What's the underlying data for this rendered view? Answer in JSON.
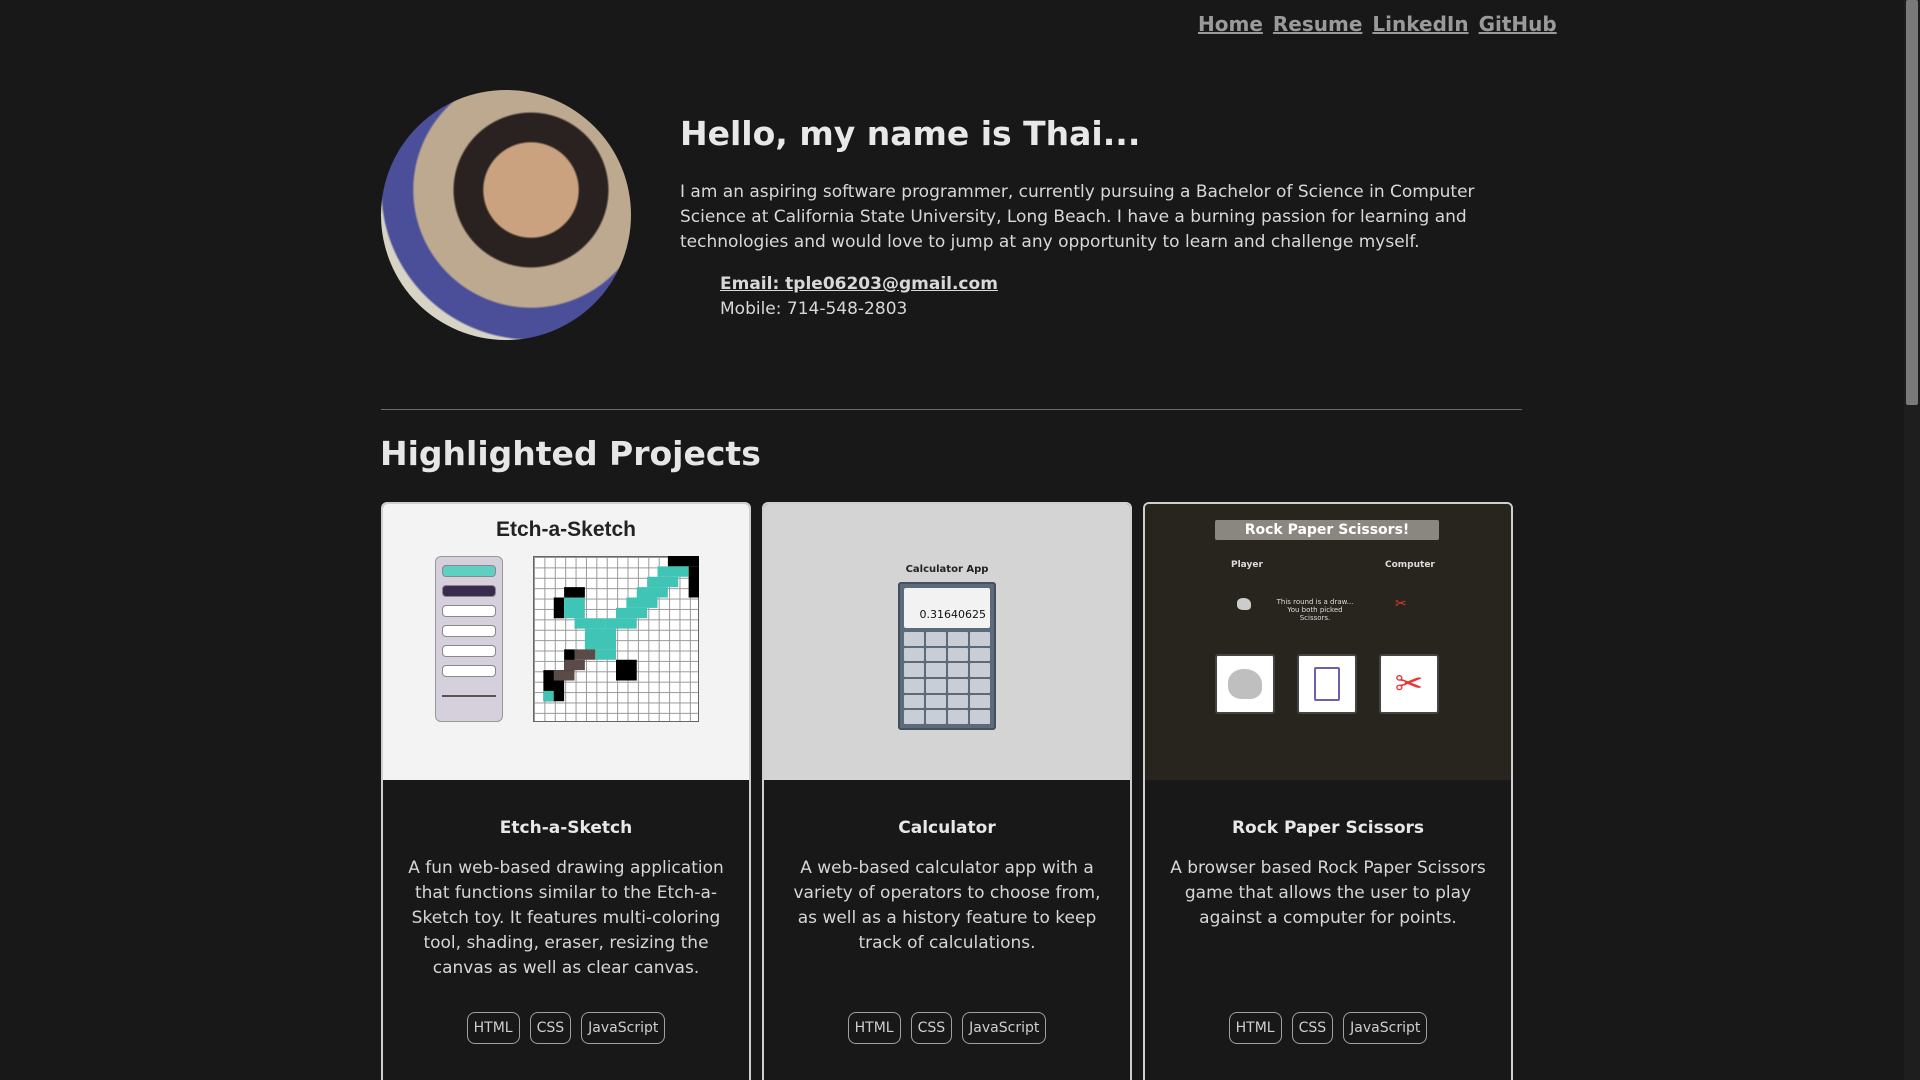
{
  "nav": [
    "Home",
    "Resume",
    "LinkedIn",
    "GitHub"
  ],
  "hero": {
    "title": "Hello, my name is Thai...",
    "bio": "I am an aspiring software programmer, currently pursuing a Bachelor of Science in Computer Science at California State University, Long Beach. I have a burning passion for learning and technologies and would love to jump at any opportunity to learn and challenge myself.",
    "email": "Email: tple06203@gmail.com",
    "mobile": "Mobile: 714-548-2803"
  },
  "section_title": "Highlighted Projects",
  "projects": [
    {
      "thumb_title": "Etch-a-Sketch",
      "name": "Etch-a-Sketch",
      "description": "A fun web-based drawing application that functions similar to the Etch-a-Sketch toy. It features multi-coloring tool, shading, eraser, resizing the canvas as well as clear canvas.",
      "tags": [
        "HTML",
        "CSS",
        "JavaScript"
      ]
    },
    {
      "thumb_title": "Calculator App",
      "screen_value": "0.31640625",
      "name": "Calculator",
      "description": "A web-based calculator app with a variety of operators to choose from, as well as a history feature to keep track of calculations.",
      "tags": [
        "HTML",
        "CSS",
        "JavaScript"
      ]
    },
    {
      "thumb_title": "Rock Paper Scissors!",
      "player_label": "Player",
      "computer_label": "Computer",
      "round_text": "This round is a draw... You both picked Scissors.",
      "name": "Rock Paper Scissors",
      "description": "A browser based Rock Paper Scissors game that allows the user to play against a computer for points.",
      "tags": [
        "HTML",
        "CSS",
        "JavaScript"
      ]
    }
  ],
  "colors": {
    "background": "#181818",
    "text": "#e6e6e6",
    "nav_link": "#9a9a9a",
    "card_border": "#cfcfcf"
  }
}
